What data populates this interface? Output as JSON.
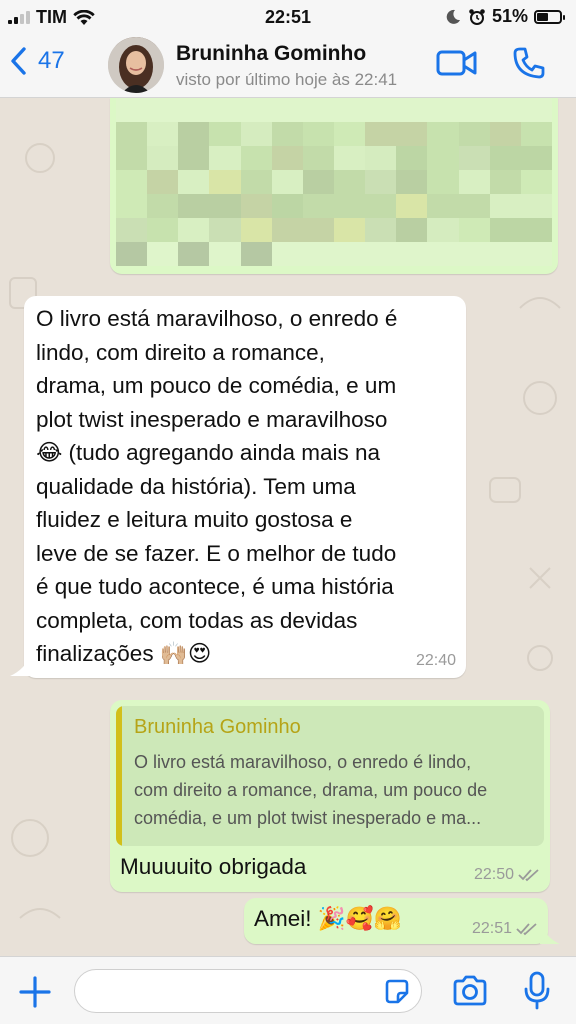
{
  "status_bar": {
    "carrier": "TIM",
    "time": "22:51",
    "battery": "51%",
    "battery_level": 0.51
  },
  "header": {
    "back_count": "47",
    "contact_name": "Bruninha Gominho",
    "last_seen": "visto por último hoje às 22:41",
    "accent_color": "#1a74e8"
  },
  "messages": [
    {
      "direction": "outgoing",
      "type": "image",
      "content": "blurred-image"
    },
    {
      "direction": "incoming",
      "lines": [
        "O livro está maravilhoso, o enredo é",
        "lindo, com direito a romance,",
        "drama, um pouco de comédia, e um",
        "plot twist inesperado e maravilhoso",
        "😂 (tudo agregando ainda mais na",
        "qualidade da história). Tem uma",
        "fluidez e leitura muito gostosa e",
        "leve de se fazer. E o melhor de tudo",
        "é que tudo acontece, é uma história",
        "completa, com todas as devidas",
        "finalizações 🙌🏼😍"
      ],
      "time": "22:40"
    },
    {
      "direction": "outgoing",
      "quote": {
        "author": "Bruninha Gominho",
        "lines": [
          "O livro está maravilhoso, o enredo é lindo,",
          "com direito a romance, drama, um pouco de",
          "comédia, e um plot twist inesperado e ma..."
        ]
      },
      "text": "Muuuuito obrigada",
      "time": "22:50",
      "status": "read"
    },
    {
      "direction": "outgoing",
      "text": "Amei! 🎉🥰🤗",
      "time": "22:51",
      "status": "read"
    }
  ],
  "colors": {
    "incoming_bubble": "#ffffff",
    "outgoing_bubble": "#dcf8c6",
    "chat_background": "#e8e1d8",
    "quote_accent": "#d2c01a"
  },
  "icons": [
    "signal-icon",
    "wifi-icon",
    "moon-icon",
    "alarm-icon",
    "battery-icon",
    "back-chevron-icon",
    "video-call-icon",
    "phone-icon",
    "plus-icon",
    "sticker-icon",
    "camera-icon",
    "microphone-icon",
    "double-check-icon"
  ]
}
